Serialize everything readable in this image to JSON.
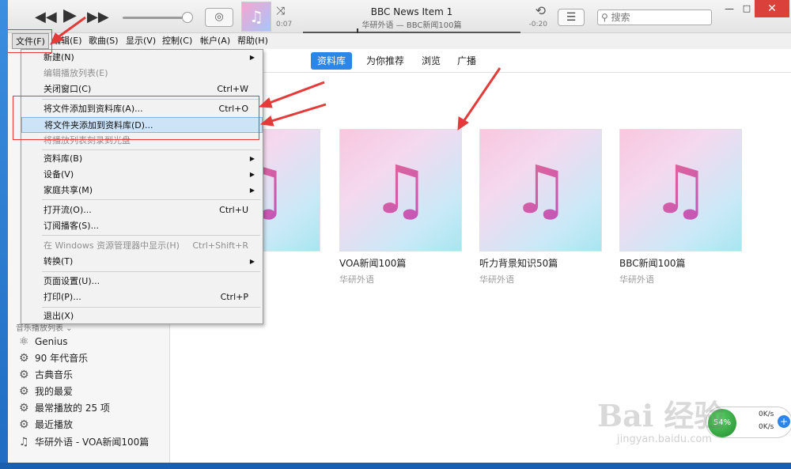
{
  "player": {
    "prev_icon": "◀◀",
    "play_icon": "▶",
    "next_icon": "▶▶",
    "airplay_icon": "◎",
    "shuffle_icon": "⤨",
    "repeat_icon": "⟲",
    "track_title": "BBC News Item 1",
    "track_subtitle": "华研外语 — BBC新闻100篇",
    "elapsed": "0:07",
    "remaining": "-0:20",
    "list_icon": "☰",
    "search_placeholder": "搜索",
    "search_icon": "⚲"
  },
  "window": {
    "minimize": "—",
    "maximize": "□",
    "close": "✕"
  },
  "menubar": {
    "file": "文件(F)",
    "edit": "编辑(E)",
    "song": "歌曲(S)",
    "view": "显示(V)",
    "controls": "控制(C)",
    "account": "帐户(A)",
    "help": "帮助(H)"
  },
  "tabs": [
    "资料库",
    "为你推荐",
    "浏览",
    "广播"
  ],
  "file_menu": [
    {
      "label": "新建(N)",
      "shortcut": "",
      "submenu": true,
      "disabled": false
    },
    {
      "label": "编辑播放列表(E)",
      "shortcut": "",
      "submenu": false,
      "disabled": true
    },
    {
      "label": "关闭窗口(C)",
      "shortcut": "Ctrl+W",
      "submenu": false,
      "disabled": false
    },
    {
      "label": "将文件添加到资料库(A)...",
      "shortcut": "Ctrl+O",
      "submenu": false,
      "disabled": false
    },
    {
      "label": "将文件夹添加到资料库(D)...",
      "shortcut": "",
      "submenu": false,
      "disabled": false
    },
    {
      "label": "将播放列表刻录到光盘",
      "shortcut": "",
      "submenu": false,
      "disabled": true
    },
    {
      "label": "资料库(B)",
      "shortcut": "",
      "submenu": true,
      "disabled": false
    },
    {
      "label": "设备(V)",
      "shortcut": "",
      "submenu": true,
      "disabled": false
    },
    {
      "label": "家庭共享(M)",
      "shortcut": "",
      "submenu": true,
      "disabled": false
    },
    {
      "label": "打开流(O)...",
      "shortcut": "Ctrl+U",
      "submenu": false,
      "disabled": false
    },
    {
      "label": "订阅播客(S)...",
      "shortcut": "",
      "submenu": false,
      "disabled": false
    },
    {
      "label": "在 Windows 资源管理器中显示(H)",
      "shortcut": "Ctrl+Shift+R",
      "submenu": false,
      "disabled": true
    },
    {
      "label": "转换(T)",
      "shortcut": "",
      "submenu": true,
      "disabled": false
    },
    {
      "label": "页面设置(U)...",
      "shortcut": "",
      "submenu": false,
      "disabled": false
    },
    {
      "label": "打印(P)...",
      "shortcut": "Ctrl+P",
      "submenu": false,
      "disabled": false
    },
    {
      "label": "退出(X)",
      "shortcut": "",
      "submenu": false,
      "disabled": false
    }
  ],
  "submenu_arrow": "▶",
  "sidebar": {
    "playlists_header": "音乐播放列表 ⌄",
    "playlists": [
      {
        "icon": "⚛",
        "label": "Genius"
      },
      {
        "icon": "⚙",
        "label": "90 年代音乐"
      },
      {
        "icon": "⚙",
        "label": "古典音乐"
      },
      {
        "icon": "⚙",
        "label": "我的最爱"
      },
      {
        "icon": "⚙",
        "label": "最常播放的 25 项"
      },
      {
        "icon": "⚙",
        "label": "最近播放"
      },
      {
        "icon": "♫",
        "label": "华研外语 - VOA新闻100篇"
      }
    ]
  },
  "albums": [
    {
      "title": "篇",
      "artist": ""
    },
    {
      "title": "VOA新闻100篇",
      "artist": "华研外语"
    },
    {
      "title": "听力背景知识50篇",
      "artist": "华研外语"
    },
    {
      "title": "BBC新闻100篇",
      "artist": "华研外语"
    }
  ],
  "album_note_icon": "♫",
  "net_widget": {
    "percent": "54%",
    "up": "0K/s",
    "down": "0K/s",
    "plus": "+"
  },
  "watermark": {
    "main": "Bai 经验",
    "sub": "jingyan.baidu.com"
  }
}
